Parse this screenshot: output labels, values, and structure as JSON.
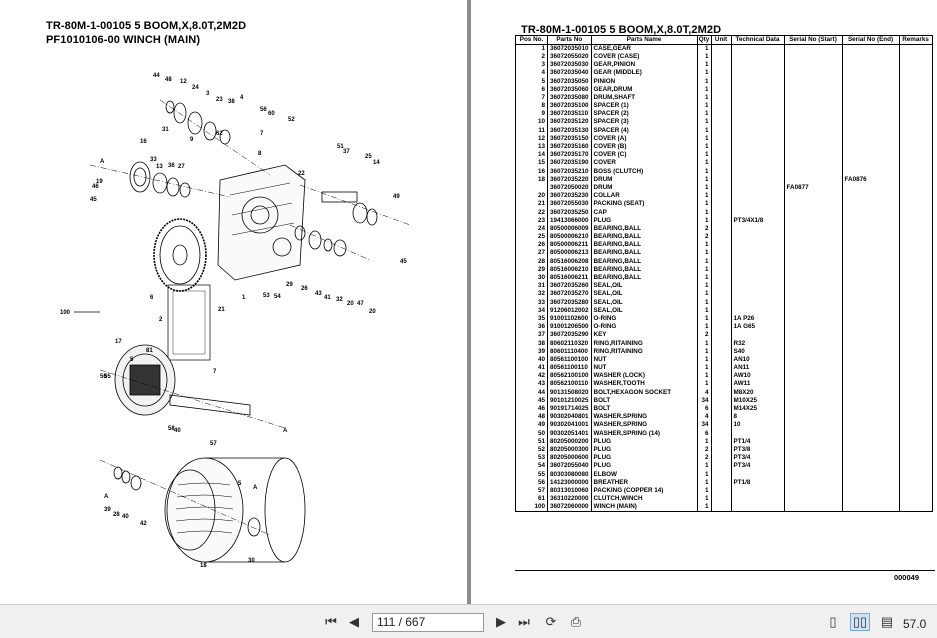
{
  "left_page": {
    "title_line1": "TR-80M-1-00105 5 BOOM,X,8.0T,2M2D",
    "title_line2": "PF1010106-00 WINCH (MAIN)",
    "callouts": [
      "44",
      "48",
      "12",
      "24",
      "3",
      "23",
      "38",
      "4",
      "56",
      "60",
      "52",
      "31",
      "9",
      "62",
      "7",
      "8",
      "16",
      "51",
      "37",
      "33",
      "13",
      "36",
      "27",
      "25",
      "14",
      "6",
      "A",
      "49",
      "45",
      "46",
      "19",
      "22",
      "21",
      "2",
      "53",
      "54",
      "29",
      "26",
      "43",
      "41",
      "32",
      "20",
      "47",
      "1",
      "100",
      "17",
      "81",
      "55",
      "50",
      "5",
      "58",
      "40",
      "57",
      "A",
      "39",
      "28",
      "40",
      "42",
      "30",
      "18",
      "10",
      "11",
      "15",
      "34",
      "61",
      "35",
      "A"
    ]
  },
  "right_page": {
    "title": "TR-80M-1-00105 5 BOOM,X,8.0T,2M2D",
    "columns": [
      "Pos No.",
      "Parts No",
      "Parts Name",
      "Qty",
      "Unit",
      "Technical Data",
      "Serial No (Start)",
      "Serial No (End)",
      "Remarks"
    ],
    "rows": [
      [
        "1",
        "36072035010",
        "CASE,GEAR",
        "1",
        "",
        "",
        "",
        "",
        ""
      ],
      [
        "2",
        "36072055020",
        "COVER (CASE)",
        "1",
        "",
        "",
        "",
        "",
        ""
      ],
      [
        "3",
        "36072035030",
        "GEAR,PINION",
        "1",
        "",
        "",
        "",
        "",
        ""
      ],
      [
        "4",
        "36072035040",
        "GEAR (MIDDLE)",
        "1",
        "",
        "",
        "",
        "",
        ""
      ],
      [
        "5",
        "36072035050",
        "PINION",
        "1",
        "",
        "",
        "",
        "",
        ""
      ],
      [
        "6",
        "36072035060",
        "GEAR,DRUM",
        "1",
        "",
        "",
        "",
        "",
        ""
      ],
      [
        "7",
        "36072035080",
        "DRUM,SHAFT",
        "1",
        "",
        "",
        "",
        "",
        ""
      ],
      [
        "8",
        "36072035100",
        "SPACER (1)",
        "1",
        "",
        "",
        "",
        "",
        ""
      ],
      [
        "9",
        "36072035110",
        "SPACER (2)",
        "1",
        "",
        "",
        "",
        "",
        ""
      ],
      [
        "10",
        "36072035120",
        "SPACER (3)",
        "1",
        "",
        "",
        "",
        "",
        ""
      ],
      [
        "11",
        "36072035130",
        "SPACER (4)",
        "1",
        "",
        "",
        "",
        "",
        ""
      ],
      [
        "12",
        "36072035150",
        "COVER (A)",
        "1",
        "",
        "",
        "",
        "",
        ""
      ],
      [
        "13",
        "36072035160",
        "COVER (B)",
        "1",
        "",
        "",
        "",
        "",
        ""
      ],
      [
        "14",
        "36072035170",
        "COVER (C)",
        "1",
        "",
        "",
        "",
        "",
        ""
      ],
      [
        "15",
        "36072035190",
        "COVER",
        "1",
        "",
        "",
        "",
        "",
        ""
      ],
      [
        "16",
        "36072035210",
        "BOSS (CLUTCH)",
        "1",
        "",
        "",
        "",
        "",
        ""
      ],
      [
        "18",
        "36072035220",
        "DRUM",
        "1",
        "",
        "",
        "",
        "FA0876",
        ""
      ],
      [
        "",
        "36072050020",
        "DRUM",
        "1",
        "",
        "",
        "FA0877",
        "",
        ""
      ],
      [
        "20",
        "36072035230",
        "COLLAR",
        "1",
        "",
        "",
        "",
        "",
        ""
      ],
      [
        "21",
        "36072055030",
        "PACKING (SEAT)",
        "1",
        "",
        "",
        "",
        "",
        ""
      ],
      [
        "22",
        "36072035250",
        "CAP",
        "1",
        "",
        "",
        "",
        "",
        ""
      ],
      [
        "23",
        "19413066000",
        "PLUG",
        "1",
        "",
        "PT3/4X1/8",
        "",
        "",
        ""
      ],
      [
        "24",
        "80500006009",
        "BEARING,BALL",
        "2",
        "",
        "",
        "",
        "",
        ""
      ],
      [
        "25",
        "80500006210",
        "BEARING,BALL",
        "2",
        "",
        "",
        "",
        "",
        ""
      ],
      [
        "26",
        "80500006211",
        "BEARING,BALL",
        "1",
        "",
        "",
        "",
        "",
        ""
      ],
      [
        "27",
        "80500006213",
        "BEARING,BALL",
        "1",
        "",
        "",
        "",
        "",
        ""
      ],
      [
        "28",
        "80516006208",
        "BEARING,BALL",
        "1",
        "",
        "",
        "",
        "",
        ""
      ],
      [
        "29",
        "80516006210",
        "BEARING,BALL",
        "1",
        "",
        "",
        "",
        "",
        ""
      ],
      [
        "30",
        "80516006211",
        "BEARING,BALL",
        "1",
        "",
        "",
        "",
        "",
        ""
      ],
      [
        "31",
        "36072035260",
        "SEAL,OIL",
        "1",
        "",
        "",
        "",
        "",
        ""
      ],
      [
        "32",
        "36072035270",
        "SEAL,OIL",
        "1",
        "",
        "",
        "",
        "",
        ""
      ],
      [
        "33",
        "36072035280",
        "SEAL,OIL",
        "1",
        "",
        "",
        "",
        "",
        ""
      ],
      [
        "34",
        "91206012002",
        "SEAL,OIL",
        "1",
        "",
        "",
        "",
        "",
        ""
      ],
      [
        "35",
        "91001102600",
        "O-RING",
        "1",
        "",
        "1A P26",
        "",
        "",
        ""
      ],
      [
        "36",
        "91001206500",
        "O-RING",
        "1",
        "",
        "1A G65",
        "",
        "",
        ""
      ],
      [
        "37",
        "36072035290",
        "KEY",
        "2",
        "",
        "",
        "",
        "",
        ""
      ],
      [
        "38",
        "80602110320",
        "RING,RITAINING",
        "1",
        "",
        "R32",
        "",
        "",
        ""
      ],
      [
        "39",
        "80601110400",
        "RING,RITAINING",
        "1",
        "",
        "S40",
        "",
        "",
        ""
      ],
      [
        "40",
        "80561100100",
        "NUT",
        "1",
        "",
        "AN10",
        "",
        "",
        ""
      ],
      [
        "41",
        "80561100110",
        "NUT",
        "1",
        "",
        "AN11",
        "",
        "",
        ""
      ],
      [
        "42",
        "80562100100",
        "WASHER (LOCK)",
        "1",
        "",
        "AW10",
        "",
        "",
        ""
      ],
      [
        "43",
        "80562100110",
        "WASHER,TOOTH",
        "1",
        "",
        "AW11",
        "",
        "",
        ""
      ],
      [
        "44",
        "90131508020",
        "BOLT,HEXAGON SOCKET",
        "4",
        "",
        "M8X20",
        "",
        "",
        ""
      ],
      [
        "45",
        "90101210025",
        "BOLT",
        "34",
        "",
        "M10X25",
        "",
        "",
        ""
      ],
      [
        "46",
        "90191714025",
        "BOLT",
        "6",
        "",
        "M14X25",
        "",
        "",
        ""
      ],
      [
        "48",
        "90302040801",
        "WASHER,SPRING",
        "4",
        "",
        "8",
        "",
        "",
        ""
      ],
      [
        "49",
        "90302041001",
        "WASHER,SPRING",
        "34",
        "",
        "10",
        "",
        "",
        ""
      ],
      [
        "50",
        "90302051401",
        "WASHER,SPRING (14)",
        "6",
        "",
        "",
        "",
        "",
        ""
      ],
      [
        "51",
        "80205000200",
        "PLUG",
        "1",
        "",
        "PT1/4",
        "",
        "",
        ""
      ],
      [
        "52",
        "80205000300",
        "PLUG",
        "2",
        "",
        "PT3/8",
        "",
        "",
        ""
      ],
      [
        "53",
        "80205000600",
        "PLUG",
        "2",
        "",
        "PT3/4",
        "",
        "",
        ""
      ],
      [
        "54",
        "36072055040",
        "PLUG",
        "1",
        "",
        "PT3/4",
        "",
        "",
        ""
      ],
      [
        "55",
        "80303080080",
        "ELBOW",
        "1",
        "",
        "",
        "",
        "",
        ""
      ],
      [
        "56",
        "14123000000",
        "BREATHER",
        "1",
        "",
        "PT1/8",
        "",
        "",
        ""
      ],
      [
        "57",
        "80313010060",
        "PACKING (COPPER 14)",
        "1",
        "",
        "",
        "",
        "",
        ""
      ],
      [
        "61",
        "36310220000",
        "CLUTCH,WINCH",
        "1",
        "",
        "",
        "",
        "",
        ""
      ],
      [
        "100",
        "36072060000",
        "WINCH (MAIN)",
        "1",
        "",
        "",
        "",
        "",
        ""
      ]
    ],
    "page_code": "000049"
  },
  "toolbar": {
    "page_input": "111 / 667",
    "zoom": "57.0"
  }
}
